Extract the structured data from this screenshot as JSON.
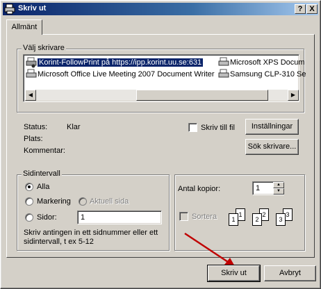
{
  "window": {
    "title": "Skriv ut",
    "help_label": "?",
    "close_label": "X"
  },
  "tabs": [
    {
      "label": "Allmänt"
    }
  ],
  "printer_group": {
    "legend": "Välj skrivare",
    "printers": [
      {
        "name": "Korint-FollowPrint på https://ipp.korint.uu.se:631",
        "selected": true
      },
      {
        "name": "Microsoft Office Live Meeting 2007 Document Writer",
        "selected": false
      },
      {
        "name": "Microsoft XPS Docum",
        "selected": false
      },
      {
        "name": "Samsung CLP-310 Se",
        "selected": false
      }
    ],
    "scroll_left": "◀",
    "scroll_right": "▶"
  },
  "status": {
    "status_label": "Status:",
    "status_value": "Klar",
    "location_label": "Plats:",
    "comment_label": "Kommentar:",
    "print_to_file_label": "Skriv till fil",
    "settings_button": "Inställningar",
    "find_printer_button": "Sök skrivare..."
  },
  "page_range": {
    "legend": "Sidintervall",
    "all_label": "Alla",
    "selection_label": "Markering",
    "current_page_label": "Aktuell sida",
    "pages_label": "Sidor:",
    "pages_value": "1",
    "hint": "Skriv antingen in ett sidnummer eller ett sidintervall, t ex 5-12"
  },
  "copies": {
    "label": "Antal kopior:",
    "value": "1",
    "collate_label": "Sortera",
    "collate_pages": [
      "1",
      "1",
      "2",
      "2",
      "3",
      "3"
    ],
    "spin_up": "▲",
    "spin_down": "▼"
  },
  "footer": {
    "print_button": "Skriv ut",
    "cancel_button": "Avbryt"
  },
  "colors": {
    "annotation_arrow": "#c00000",
    "selection": "#0a246a"
  }
}
